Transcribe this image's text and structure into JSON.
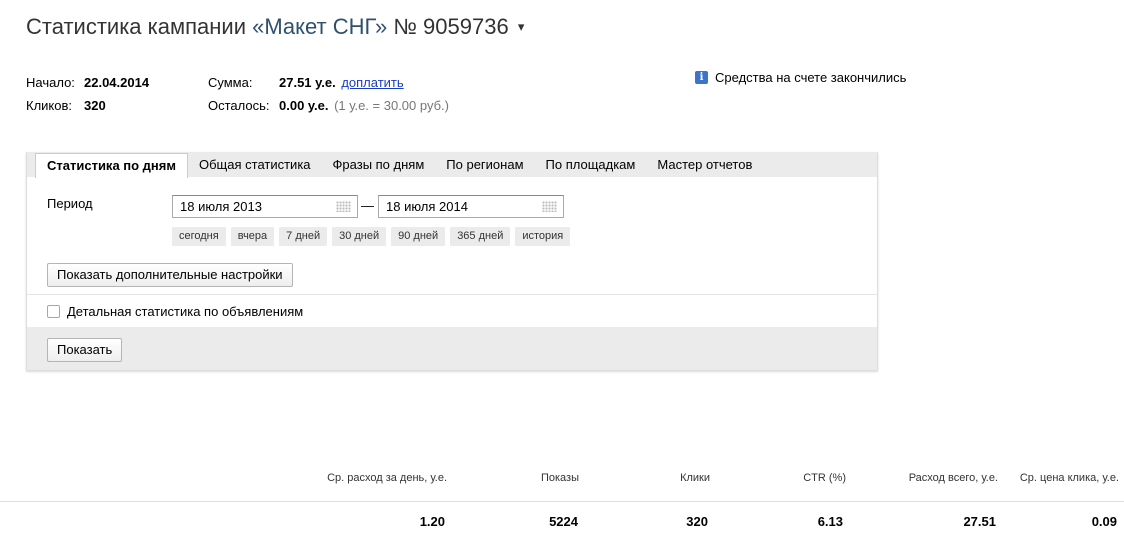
{
  "header": {
    "title_prefix": "Статистика кампании",
    "campaign_name": "«Макет СНГ»",
    "campaign_number": "№ 9059736",
    "caret": "▾"
  },
  "summary": {
    "start_label": "Начало:",
    "start_value": "22.04.2014",
    "clicks_label": "Кликов:",
    "clicks_value": "320",
    "sum_label": "Сумма:",
    "sum_value": "27.51 у.е.",
    "topup_link": "доплатить",
    "left_label": "Осталось:",
    "left_value": "0.00 у.е.",
    "rate_note": "(1 у.е. = 30.00 руб.)"
  },
  "notice": {
    "icon": "info-icon",
    "icon_glyph": "i",
    "text": "Средства на счете закончились"
  },
  "tabs": [
    {
      "label": "Статистика по дням",
      "active": true
    },
    {
      "label": "Общая статистика",
      "active": false
    },
    {
      "label": "Фразы по дням",
      "active": false
    },
    {
      "label": "По регионам",
      "active": false
    },
    {
      "label": "По площадкам",
      "active": false
    },
    {
      "label": "Мастер отчетов",
      "active": false
    }
  ],
  "period": {
    "label": "Период",
    "from": "18 июля 2013",
    "to": "18 июля 2014",
    "separator": "—",
    "quick_ranges": [
      "сегодня",
      "вчера",
      "7 дней",
      "30 дней",
      "90 дней",
      "365 дней",
      "история"
    ]
  },
  "buttons": {
    "more_settings": "Показать дополнительные настройки",
    "show": "Показать"
  },
  "checkbox": {
    "label": "Детальная статистика по объявлениям",
    "checked": false
  },
  "stats_table": {
    "headers": [
      "Ср. расход за день, у.е.",
      "Показы",
      "Клики",
      "CTR (%)",
      "Расход всего, у.е.",
      "Ср. цена клика, у.е."
    ],
    "values": [
      "1.20",
      "5224",
      "320",
      "6.13",
      "27.51",
      "0.09"
    ]
  }
}
